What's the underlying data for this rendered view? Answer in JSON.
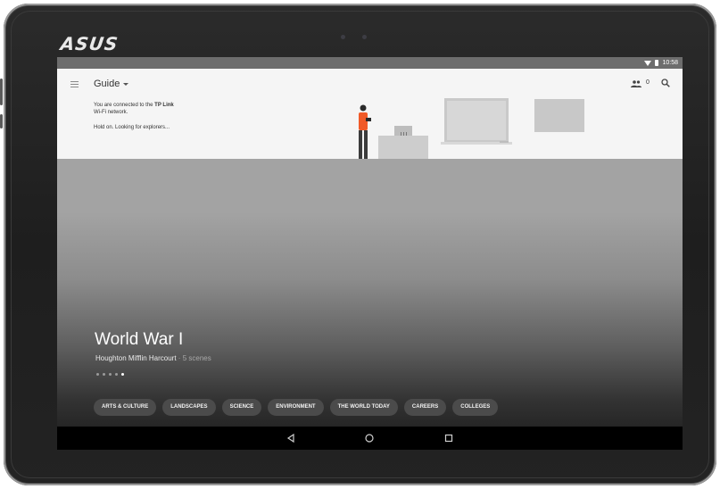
{
  "device": {
    "brand": "ASUS"
  },
  "status_bar": {
    "time": "10:58",
    "wifi_icon": "wifi-icon",
    "battery_icon": "battery-icon"
  },
  "app_bar": {
    "menu_icon": "menu-icon",
    "title": "Guide",
    "dropdown_icon": "caret-down-icon",
    "explorers_icon": "people-icon",
    "explorers_count": "0",
    "search_icon": "search-icon"
  },
  "status_message": {
    "line1_prefix": "You are connected to the",
    "network_name": "TP Link",
    "line2": "Wi-Fi network.",
    "searching": "Hold on. Looking for explorers..."
  },
  "hero": {
    "title": "World War I",
    "publisher": "Houghton Mifflin Harcourt",
    "separator": "·",
    "scenes": "5 scenes",
    "page_dots_count": 5,
    "active_dot": 5
  },
  "categories": [
    "ARTS & CULTURE",
    "LANDSCAPES",
    "SCIENCE",
    "ENVIRONMENT",
    "THE WORLD TODAY",
    "CAREERS",
    "COLLEGES"
  ],
  "nav_bar": {
    "back_icon": "back-icon",
    "home_icon": "home-icon",
    "recents_icon": "recents-icon"
  },
  "colors": {
    "accent_orange": "#f05a28",
    "chip_bg": "#4b4b4b",
    "app_bar_bg": "#f5f5f5"
  }
}
